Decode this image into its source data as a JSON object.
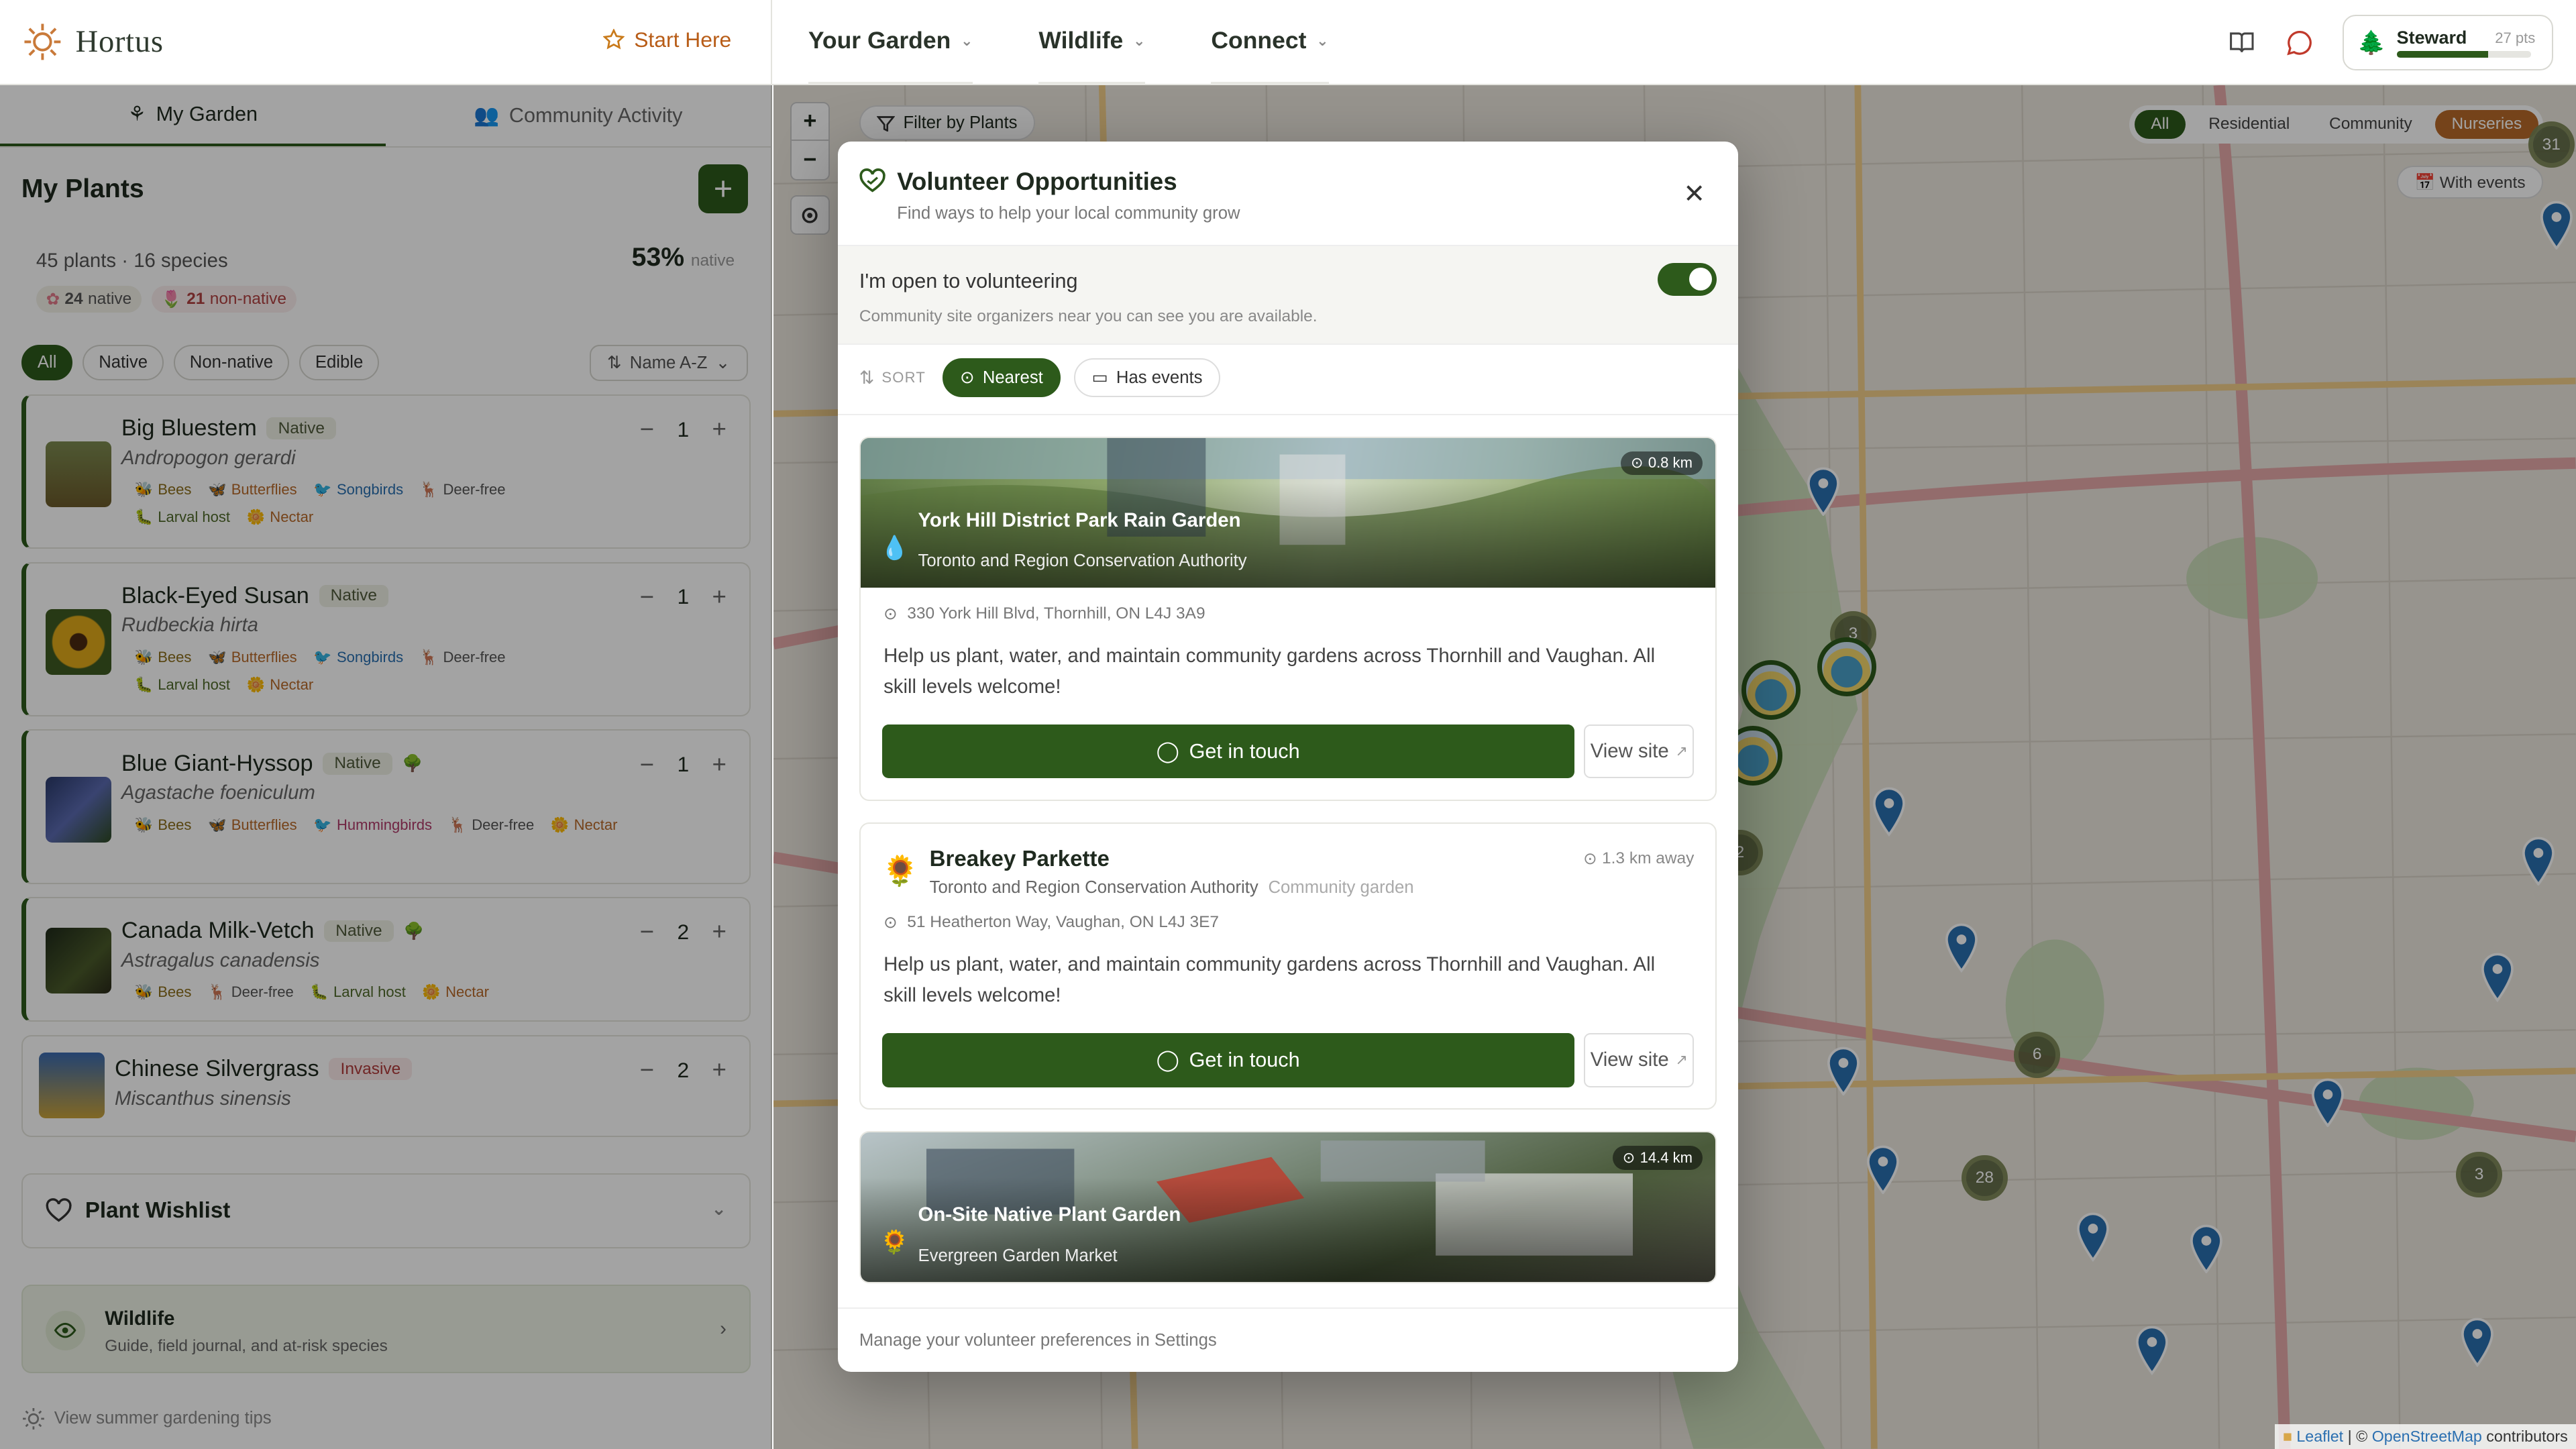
{
  "app": {
    "brand": "Hortus",
    "start_here": "Start Here"
  },
  "nav": [
    {
      "label": "Your Garden"
    },
    {
      "label": "Wildlife"
    },
    {
      "label": "Connect"
    }
  ],
  "steward": {
    "label": "Steward",
    "points": "27 pts",
    "progress": 0.68
  },
  "sidebar": {
    "tabs": [
      {
        "label": "My Garden"
      },
      {
        "label": "Community Activity"
      }
    ],
    "title": "My Plants",
    "stats": "45 plants · 16 species",
    "native_pct": "53%",
    "native_word": "native",
    "native_count": "24",
    "native_label": "native",
    "nonnative_count": "21",
    "nonnative_label": "non-native",
    "filters": [
      "All",
      "Native",
      "Non-native",
      "Edible"
    ],
    "sort": "Name A-Z",
    "plants": [
      {
        "name": "Big Bluestem",
        "tag": "Native",
        "sci": "Andropogon gerardi",
        "qty": "1",
        "traits": [
          "Bees",
          "Butterflies",
          "Songbirds",
          "Deer-free",
          "Larval host",
          "Nectar"
        ]
      },
      {
        "name": "Black-Eyed Susan",
        "tag": "Native",
        "sci": "Rudbeckia hirta",
        "qty": "1",
        "traits": [
          "Bees",
          "Butterflies",
          "Songbirds",
          "Deer-free",
          "Larval host",
          "Nectar"
        ]
      },
      {
        "name": "Blue Giant-Hyssop",
        "tag": "Native",
        "sci": "Agastache foeniculum",
        "qty": "1",
        "traits": [
          "Bees",
          "Butterflies",
          "Hummingbirds",
          "Deer-free",
          "Nectar"
        ]
      },
      {
        "name": "Canada Milk-Vetch",
        "tag": "Native",
        "sci": "Astragalus canadensis",
        "qty": "2",
        "traits": [
          "Bees",
          "Deer-free",
          "Larval host",
          "Nectar"
        ]
      },
      {
        "name": "Chinese Silvergrass",
        "tag": "Invasive",
        "sci": "Miscanthus sinensis",
        "qty": "2",
        "traits": []
      }
    ],
    "wishlist": "Plant Wishlist",
    "wildlife": {
      "title": "Wildlife",
      "subtitle": "Guide, field journal, and at-risk species"
    },
    "tips": "View summer gardening tips"
  },
  "map": {
    "filter": "Filter by Plants",
    "segments": [
      "All",
      "Residential",
      "Community",
      "Nurseries"
    ],
    "with_events": "With events",
    "attr_leaflet": "Leaflet",
    "attr_sep": " | © ",
    "attr_osm": "OpenStreetMap",
    "attr_tail": " contributors",
    "clusters": [
      "3",
      "6",
      "28",
      "3",
      "2",
      "31"
    ]
  },
  "modal": {
    "title": "Volunteer Opportunities",
    "subtitle": "Find ways to help your local community grow",
    "open_label": "I'm open to volunteering",
    "open_sub": "Community site organizers near you can see you are available.",
    "sort_label": "SORT",
    "sort_nearest": "Nearest",
    "sort_events": "Has events",
    "items": [
      {
        "name": "York Hill District Park Rain Garden",
        "org": "Toronto and Region Conservation Authority",
        "dist": "0.8 km",
        "addr": "330 York Hill Blvd, Thornhill, ON L4J 3A9",
        "desc": "Help us plant, water, and maintain community gardens across Thornhill and Vaughan. All skill levels welcome!",
        "cta": "Get in touch",
        "site": "View site"
      },
      {
        "name": "Breakey Parkette",
        "org": "Toronto and Region Conservation Authority",
        "type": "Community garden",
        "dist": "1.3 km away",
        "addr": "51 Heatherton Way, Vaughan, ON L4J 3E7",
        "desc": "Help us plant, water, and maintain community gardens across Thornhill and Vaughan. All skill levels welcome!",
        "cta": "Get in touch",
        "site": "View site"
      },
      {
        "name": "On-Site Native Plant Garden",
        "org": "Evergreen Garden Market",
        "dist": "14.4 km"
      }
    ],
    "footer": "Manage your volunteer preferences in Settings"
  }
}
